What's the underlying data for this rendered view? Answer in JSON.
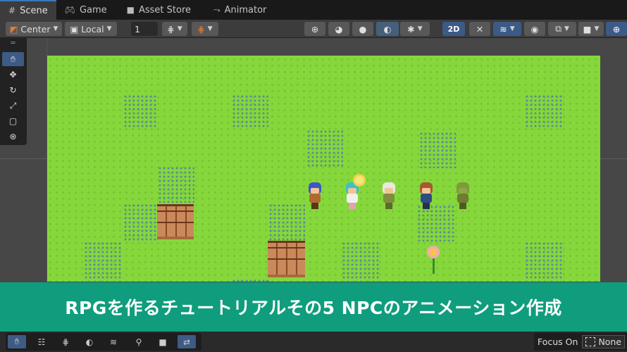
{
  "tabs": [
    {
      "label": "Scene",
      "icon": "grid-icon",
      "active": true
    },
    {
      "label": "Game",
      "icon": "gamepad-icon",
      "active": false
    },
    {
      "label": "Asset Store",
      "icon": "bag-icon",
      "active": false
    },
    {
      "label": "Animator",
      "icon": "animator-icon",
      "active": false
    }
  ],
  "toolbar": {
    "pivot_label": "Center",
    "space_label": "Local",
    "grid_size_value": "1",
    "mode_2d_label": "2D"
  },
  "banner": {
    "title": "RPGを作るチュートリアルその5 NPCのアニメーション作成"
  },
  "bottom": {
    "focus_label": "Focus On",
    "focus_value": "None"
  },
  "colors": {
    "grass": "#86d73c",
    "banner": "#0f9d7d",
    "accent": "#3d5b84",
    "tab_accent": "#3a79bb"
  }
}
